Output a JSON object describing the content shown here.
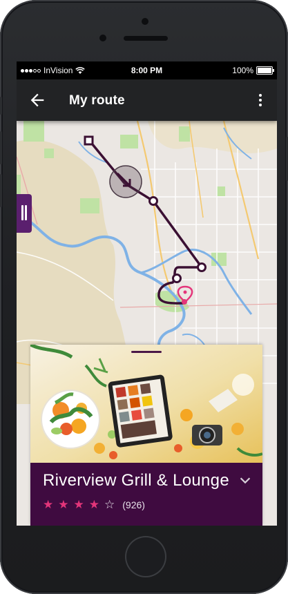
{
  "status_bar": {
    "carrier": "InVision",
    "time": "8:00 PM",
    "battery": "100%",
    "signal_dots_filled": 3,
    "signal_dots_total": 5
  },
  "app_bar": {
    "title": "My route",
    "back_icon": "arrow-left-icon",
    "menu_icon": "more-vert-icon"
  },
  "map": {
    "route_color": "#3b1033",
    "marker_color": "#e4357a"
  },
  "place_card": {
    "name": "Riverview Grill & Lounge",
    "rating": 4,
    "rating_max": 5,
    "review_count": "(926)",
    "accent_color": "#3f0b40",
    "star_color": "#e4357a"
  }
}
